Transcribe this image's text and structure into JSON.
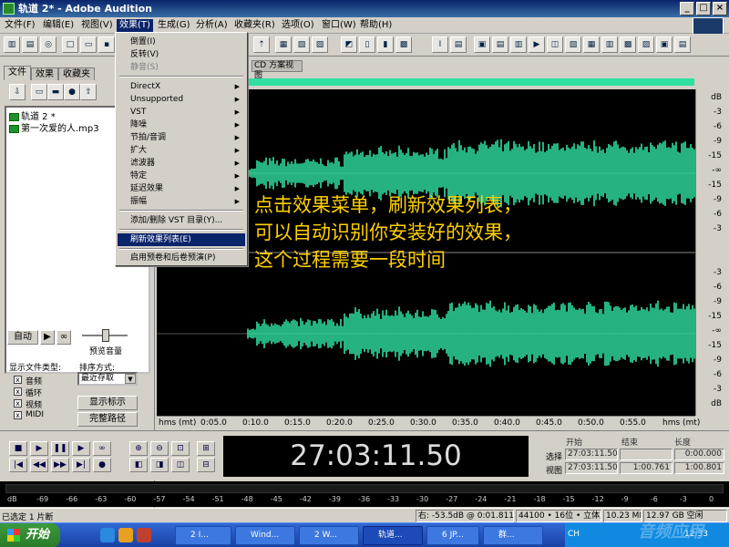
{
  "window": {
    "title": "轨道 2* - Adobe Audition"
  },
  "menubar": {
    "items": [
      "文件(F)",
      "编辑(E)",
      "视图(V)",
      "效果(T)",
      "生成(G)",
      "分析(A)",
      "收藏夹(R)",
      "选项(O)",
      "窗口(W)",
      "帮助(H)"
    ]
  },
  "effects_menu": {
    "group1": [
      "倒置(I)",
      "反转(V)",
      "静音(S)"
    ],
    "group2": [
      "DirectX",
      "Unsupported",
      "VST",
      "降噪",
      "节拍/音调",
      "扩大",
      "滤波器",
      "特定",
      "延迟效果",
      "振幅"
    ],
    "item_vst": "添加/删除 VST 目录(Y)...",
    "item_refresh": "刷新效果列表(E)",
    "item_preroll": "启用预卷和后卷预演(P)"
  },
  "left_panel": {
    "tabs": [
      "文件",
      "效果",
      "收藏夹"
    ],
    "files": [
      "轨道 2 *",
      "第一次爱的人.mp3"
    ],
    "auto_label": "自动",
    "preview_volume": "预览音量",
    "show_types_label": "显示文件类型:",
    "sort_label": "排序方式:",
    "sort_value": "最近存取",
    "file_types": [
      "音频",
      "循环",
      "视频",
      "MIDI"
    ],
    "btn_show_all": "显示标示",
    "btn_full_path": "完整路径"
  },
  "wave": {
    "tab_label": "CD 方案视图",
    "db_labels_top": [
      "dB",
      "-3",
      "-6",
      "-9",
      "-15",
      "-∞",
      "-15",
      "-9",
      "-6",
      "-3"
    ],
    "db_labels_bottom": [
      "-3",
      "-6",
      "-9",
      "-15",
      "-∞",
      "-15",
      "-9",
      "-6",
      "-3",
      "dB"
    ],
    "timeline": [
      "hms (mt)",
      "0:05.0",
      "0:10.0",
      "0:15.0",
      "0:20.0",
      "0:25.0",
      "0:30.0",
      "0:35.0",
      "0:40.0",
      "0:45.0",
      "0:50.0",
      "0:55.0",
      "hms (mt)"
    ]
  },
  "annotation": {
    "lines": [
      "点击效果菜单，刷新效果列表，",
      "可以自动识别你安装好的效果，",
      "这个过程需要一段时间"
    ]
  },
  "transport": {
    "time": "27:03:11.50",
    "headers": [
      "开始",
      "结束",
      "长度"
    ],
    "row_select_label": "选择",
    "row_view_label": "视图",
    "select_values": [
      "27:03:11.50",
      "",
      "0:00.000"
    ],
    "view_values": [
      "27:03:11.50",
      "1:00.761",
      "1:00.801"
    ]
  },
  "level_meter": {
    "labels": [
      "dB",
      "-69",
      "-66",
      "-63",
      "-60",
      "-57",
      "-54",
      "-51",
      "-48",
      "-45",
      "-42",
      "-39",
      "-36",
      "-33",
      "-30",
      "-27",
      "-24",
      "-21",
      "-18",
      "-15",
      "-12",
      "-9",
      "-6",
      "-3",
      "0"
    ]
  },
  "statusbar": {
    "left": "已选定 1 片断",
    "min_db": "右: -53.5dB @ 0:01.811",
    "format": "44100 • 16位 • 立体声",
    "size": "10.23 MB",
    "free": "12.97 GB 空闲"
  },
  "taskbar": {
    "start": "开始",
    "tasks": [
      "2 I...",
      "Wind...",
      "2 W...",
      "轨道...",
      "6 JP...",
      "群..."
    ],
    "lang": "CH",
    "clock": "12:33"
  },
  "watermark": "音频应用",
  "colors": {
    "wave": "#2fe0a0",
    "overlay": "#ffd100",
    "menu_highlight": "#0a246a"
  }
}
